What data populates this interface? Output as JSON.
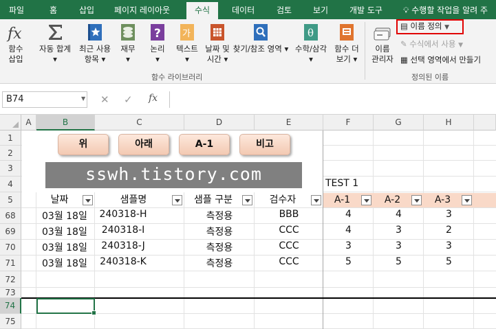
{
  "ribbon_tabs": [
    "파일",
    "홈",
    "삽입",
    "페이지 레이아웃",
    "수식",
    "데이터",
    "검토",
    "보기",
    "개발 도구"
  ],
  "active_tab": "수식",
  "tell_me": "수행할 작업을 알려 주",
  "ribbon": {
    "function_library": {
      "insert_function": [
        "함수",
        "삽입"
      ],
      "autosum": [
        "자동 합계",
        "▾"
      ],
      "recent": [
        "최근 사용",
        "항목 ▾"
      ],
      "financial": [
        "재무",
        "▾"
      ],
      "logical": [
        "논리",
        "▾"
      ],
      "text": [
        "텍스트",
        "▾"
      ],
      "datetime": [
        "날짜 및",
        "시간 ▾"
      ],
      "lookup": [
        "찾기/참조",
        "영역 ▾"
      ],
      "math": [
        "수학/삼각",
        "▾"
      ],
      "more": [
        "함수 더",
        "보기 ▾"
      ],
      "group_label": "함수 라이브러리"
    },
    "defined_names": {
      "name_manager": [
        "이름",
        "관리자"
      ],
      "define_name": "이름 정의",
      "use_in_formula": "수식에서 사용",
      "create_from_selection": "선택 영역에서 만들기",
      "group_label": "정의된 이름"
    }
  },
  "formula_bar": {
    "name_box": "B74",
    "fx_label": "fx",
    "formula": ""
  },
  "columns": [
    "A",
    "B",
    "C",
    "D",
    "E",
    "F",
    "G",
    "H"
  ],
  "selected_column": "B",
  "rows": [
    "1",
    "2",
    "3",
    "4",
    "5",
    "68",
    "69",
    "70",
    "71",
    "72",
    "73",
    "74",
    "75"
  ],
  "selected_row": "74",
  "sheet_buttons": [
    "위",
    "아래",
    "A-1",
    "비고"
  ],
  "banner_text": "sswh.tistory.com",
  "test_label": "TEST 1",
  "headers": [
    "날짜",
    "샘플명",
    "샘플 구분",
    "검수자",
    "A-1",
    "A-2",
    "A-3"
  ],
  "data_rows": [
    {
      "row": "68",
      "date": "03월 18일",
      "sample": "240318-H",
      "type": "측정용",
      "inspector": "BBB",
      "a1": "4",
      "a2": "4",
      "a3": "3"
    },
    {
      "row": "69",
      "date": "03월 18일",
      "sample": "240318-I",
      "type": "측정용",
      "inspector": "CCC",
      "a1": "4",
      "a2": "3",
      "a3": "2"
    },
    {
      "row": "70",
      "date": "03월 18일",
      "sample": "240318-J",
      "type": "측정용",
      "inspector": "CCC",
      "a1": "3",
      "a2": "3",
      "a3": "3"
    },
    {
      "row": "71",
      "date": "03월 18일",
      "sample": "240318-K",
      "type": "측정용",
      "inspector": "CCC",
      "a1": "5",
      "a2": "5",
      "a3": "5"
    }
  ],
  "colors": {
    "accent": "#217346",
    "highlight": "#e00000",
    "header_peach": "#f9d9c8"
  },
  "icons": [
    "fx-icon",
    "sigma-icon",
    "star-book-icon",
    "coins-book-icon",
    "question-book-icon",
    "text-book-icon",
    "calendar-book-icon",
    "search-book-icon",
    "theta-book-icon",
    "more-book-icon",
    "tag-icon",
    "lightbulb-icon"
  ]
}
